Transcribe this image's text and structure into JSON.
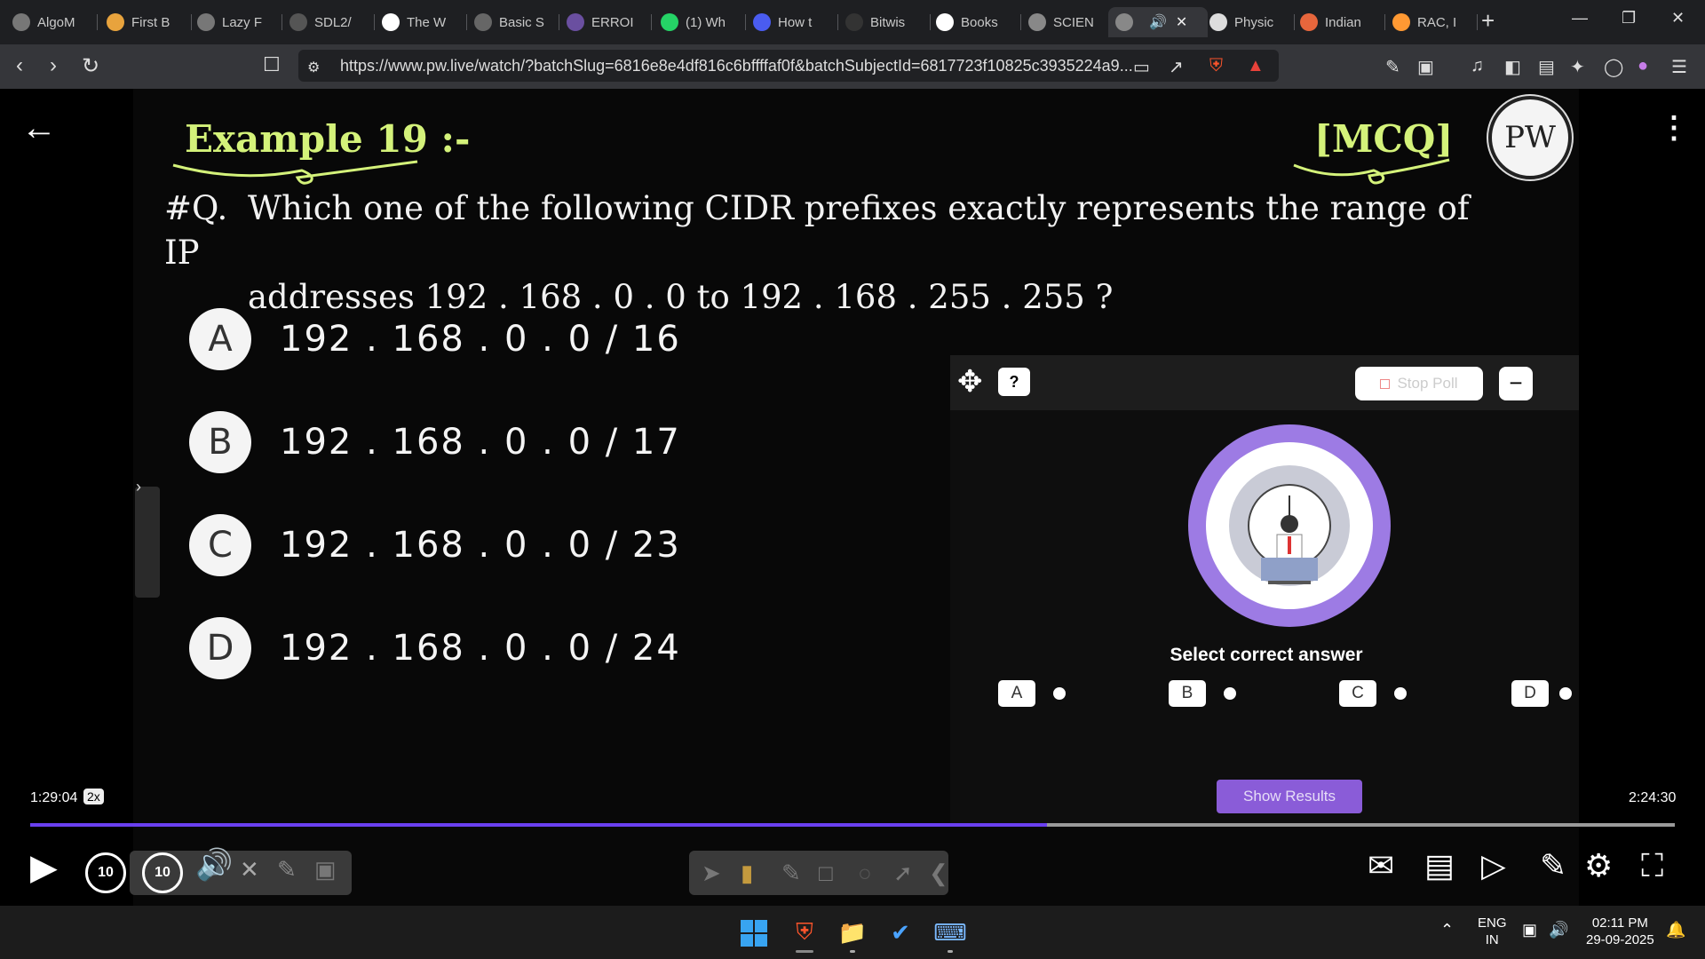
{
  "browser": {
    "tabs": [
      {
        "label": "AlgoM",
        "icon": "algomaster-icon",
        "color": "#777"
      },
      {
        "label": "First B",
        "icon": "lightning-icon",
        "color": "#e8a33d"
      },
      {
        "label": "Lazy F",
        "icon": "openai-icon",
        "color": "#777"
      },
      {
        "label": "SDL2/",
        "icon": "sdl-icon",
        "color": "#555"
      },
      {
        "label": "The W",
        "icon": "wordpress-icon",
        "color": "#fff"
      },
      {
        "label": "Basic S",
        "icon": "doc-icon",
        "color": "#666"
      },
      {
        "label": "ERROI",
        "icon": "globe-icon",
        "color": "#6a4fa0"
      },
      {
        "label": "(1) Wh",
        "icon": "whatsapp-icon",
        "color": "#25d366"
      },
      {
        "label": "How t",
        "icon": "bookmark-icon",
        "color": "#4a5cf0"
      },
      {
        "label": "Bitwis",
        "icon": "gfg-icon",
        "color": "#333"
      },
      {
        "label": "Books",
        "icon": "google-icon",
        "color": "#fff"
      },
      {
        "label": "SCIEN",
        "icon": "globe-icon",
        "color": "#888"
      },
      {
        "label": "",
        "icon": "audio-icon",
        "color": "#888"
      },
      {
        "label": "Physic",
        "icon": "wiki-icon",
        "color": "#ddd"
      },
      {
        "label": "Indian",
        "icon": "site-icon",
        "color": "#e7663c"
      },
      {
        "label": "RAC, I",
        "icon": "flag-icon",
        "color": "#ff9933"
      }
    ],
    "url": "https://www.pw.live/watch/?batchSlug=6816e8e4df816c6bffffaf0f&batchSubjectId=6817723f10825c3935224a9...",
    "brave_badge": "1"
  },
  "slide": {
    "title": "Example 19 :-",
    "tag": "[MCQ]",
    "logo": "PW",
    "question_prefix": "#Q.",
    "question_line1": "Which one of the following CIDR prefixes exactly represents the range of IP",
    "question_line2": "addresses 192 . 168 . 0 . 0  to  192 . 168 . 255 . 255 ?",
    "options": [
      {
        "letter": "A",
        "text": "192 . 168 . 0 . 0 / 16"
      },
      {
        "letter": "B",
        "text": "192 . 168 . 0 . 0 / 17"
      },
      {
        "letter": "C",
        "text": "192 . 168 . 0 . 0 / 23"
      },
      {
        "letter": "D",
        "text": "192 . 168 . 0 . 0 / 24"
      }
    ]
  },
  "poll": {
    "help": "?",
    "stop_label": "Stop Poll",
    "minimize": "−",
    "prompt": "Select correct answer",
    "choices": [
      "A",
      "B",
      "C",
      "D"
    ],
    "show_results": "Show Results"
  },
  "player": {
    "current_time": "1:29:04",
    "speed": "2x",
    "total_time": "2:24:30",
    "progress": 0.6185,
    "rewind": "10",
    "forward": "10"
  },
  "taskbar": {
    "lang": "ENG",
    "region": "IN",
    "time": "02:11 PM",
    "date": "29-09-2025"
  }
}
